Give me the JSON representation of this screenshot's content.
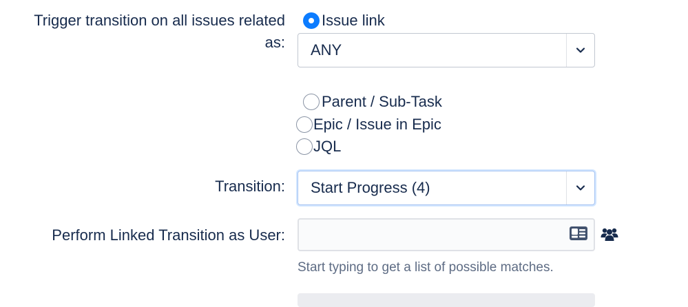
{
  "trigger": {
    "label_line1": "Trigger transition on all issues related",
    "label_line2": "as:",
    "options": [
      {
        "label": "Issue link",
        "checked": true
      },
      {
        "label": "Parent / Sub-Task",
        "checked": false
      },
      {
        "label": "Epic / Issue in Epic",
        "checked": false
      },
      {
        "label": "JQL",
        "checked": false
      }
    ],
    "issue_link_select": {
      "value": "ANY",
      "icon": "chevron-down-icon"
    }
  },
  "transition": {
    "label": "Transition:",
    "select": {
      "value": "Start Progress (4)",
      "icon": "chevron-down-icon"
    }
  },
  "linked_user": {
    "label": "Perform Linked Transition as User:",
    "input_value": "",
    "card_icon": "user-card-icon",
    "group_icon": "user-group-icon",
    "hint": "Start typing to get a list of possible matches."
  },
  "colors": {
    "accent": "#0c7cff",
    "text": "#172b4d",
    "hint": "#5e6c84",
    "border": "#c1c7d0"
  }
}
